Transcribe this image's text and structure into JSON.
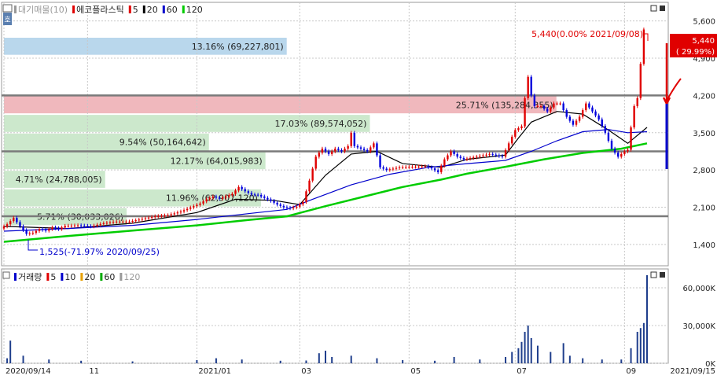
{
  "chart_data": [
    {
      "type": "candlestick",
      "legend": [
        {
          "text": "대기매물(10)",
          "color": "#999999",
          "marker": "#999999"
        },
        {
          "text": "에코플라스틱",
          "color": "#222222",
          "marker": "#e00000"
        },
        {
          "text": "5",
          "color": "#222222",
          "marker": "#e00000"
        },
        {
          "text": "20",
          "color": "#222222",
          "marker": "#000000"
        },
        {
          "text": "60",
          "color": "#222222",
          "marker": "#0000cc"
        },
        {
          "text": "120",
          "color": "#222222",
          "marker": "#00cc00"
        }
      ],
      "y_ticks": [
        {
          "v": 5600,
          "label": "5,600"
        },
        {
          "v": 4900,
          "label": "4,900"
        },
        {
          "v": 4200,
          "label": "4,200"
        },
        {
          "v": 3500,
          "label": "3,500"
        },
        {
          "v": 2800,
          "label": "2,800"
        },
        {
          "v": 2100,
          "label": "2,100"
        },
        {
          "v": 1400,
          "label": "1,400"
        }
      ],
      "ylim": [
        1000,
        5950
      ],
      "x_labels": [
        {
          "t": 0,
          "label": "2020/09/14"
        },
        {
          "t": 0.13,
          "label": "11"
        },
        {
          "t": 0.3,
          "label": "2021/01"
        },
        {
          "t": 0.46,
          "label": "03"
        },
        {
          "t": 0.63,
          "label": "05"
        },
        {
          "t": 0.795,
          "label": "07"
        },
        {
          "t": 0.965,
          "label": "09"
        }
      ],
      "end_date_label": "2021/09/15",
      "volume_profile": [
        {
          "label": "13.16% (69,227,801)",
          "from": 4950,
          "to": 5300,
          "share": 13.16,
          "color": "#b9d7ec"
        },
        {
          "label": "25.71% (135,284,355)",
          "from": 3850,
          "to": 4200,
          "share": 25.71,
          "color": "#f0b8bd"
        },
        {
          "label": "17.03% (89,574,052)",
          "from": 3500,
          "to": 3850,
          "share": 17.03,
          "color": "#cce8cc"
        },
        {
          "label": "9.54% (50,164,642)",
          "from": 3150,
          "to": 3500,
          "share": 9.54,
          "color": "#cce8cc"
        },
        {
          "label": "12.17% (64,015,983)",
          "from": 2800,
          "to": 3150,
          "share": 12.17,
          "color": "#cce8cc"
        },
        {
          "label": "4.71% (24,788,005)",
          "from": 2450,
          "to": 2800,
          "share": 4.71,
          "color": "#cce8cc"
        },
        {
          "label": "11.96% (62,907,120)",
          "from": 2100,
          "to": 2450,
          "share": 11.96,
          "color": "#cce8cc"
        },
        {
          "label": "5.71% (30,033,026)",
          "from": 1750,
          "to": 2100,
          "share": 5.71,
          "color": "#cce8cc"
        }
      ],
      "horizontal_levels": [
        4200,
        3150,
        1930
      ],
      "annotations": {
        "high": "5,440(0.00% 2021/09/08)",
        "low": "1,525(-71.97% 2020/09/25)",
        "last_price": "5,440",
        "last_change": "( 29.99%)"
      },
      "price_points": [
        [
          0,
          1700
        ],
        [
          0.01,
          1780
        ],
        [
          0.02,
          1900
        ],
        [
          0.03,
          1740
        ],
        [
          0.04,
          1600
        ],
        [
          0.05,
          1620
        ],
        [
          0.06,
          1690
        ],
        [
          0.07,
          1660
        ],
        [
          0.08,
          1720
        ],
        [
          0.09,
          1690
        ],
        [
          0.1,
          1750
        ],
        [
          0.12,
          1760
        ],
        [
          0.14,
          1740
        ],
        [
          0.16,
          1800
        ],
        [
          0.18,
          1830
        ],
        [
          0.2,
          1830
        ],
        [
          0.22,
          1880
        ],
        [
          0.24,
          1930
        ],
        [
          0.26,
          1950
        ],
        [
          0.28,
          2020
        ],
        [
          0.3,
          2120
        ],
        [
          0.31,
          2170
        ],
        [
          0.32,
          2250
        ],
        [
          0.33,
          2300
        ],
        [
          0.34,
          2260
        ],
        [
          0.36,
          2350
        ],
        [
          0.37,
          2480
        ],
        [
          0.38,
          2400
        ],
        [
          0.39,
          2340
        ],
        [
          0.4,
          2330
        ],
        [
          0.42,
          2220
        ],
        [
          0.43,
          2150
        ],
        [
          0.44,
          2100
        ],
        [
          0.45,
          2080
        ],
        [
          0.46,
          2110
        ],
        [
          0.47,
          2200
        ],
        [
          0.48,
          2600
        ],
        [
          0.49,
          3050
        ],
        [
          0.5,
          3200
        ],
        [
          0.51,
          3100
        ],
        [
          0.52,
          3200
        ],
        [
          0.53,
          3150
        ],
        [
          0.54,
          3250
        ],
        [
          0.545,
          3500
        ],
        [
          0.55,
          3250
        ],
        [
          0.56,
          3200
        ],
        [
          0.57,
          3150
        ],
        [
          0.58,
          3300
        ],
        [
          0.59,
          2850
        ],
        [
          0.6,
          2800
        ],
        [
          0.62,
          2850
        ],
        [
          0.64,
          2860
        ],
        [
          0.66,
          2870
        ],
        [
          0.67,
          2830
        ],
        [
          0.68,
          2760
        ],
        [
          0.69,
          3000
        ],
        [
          0.7,
          3150
        ],
        [
          0.71,
          3050
        ],
        [
          0.72,
          3000
        ],
        [
          0.74,
          3050
        ],
        [
          0.76,
          3100
        ],
        [
          0.78,
          3050
        ],
        [
          0.79,
          3300
        ],
        [
          0.8,
          3550
        ],
        [
          0.81,
          3620
        ],
        [
          0.815,
          4150
        ],
        [
          0.82,
          4550
        ],
        [
          0.825,
          4200
        ],
        [
          0.83,
          4000
        ],
        [
          0.84,
          4000
        ],
        [
          0.85,
          3900
        ],
        [
          0.86,
          4050
        ],
        [
          0.87,
          4050
        ],
        [
          0.88,
          3800
        ],
        [
          0.89,
          3650
        ],
        [
          0.9,
          3800
        ],
        [
          0.91,
          4050
        ],
        [
          0.92,
          3900
        ],
        [
          0.93,
          3750
        ],
        [
          0.94,
          3500
        ],
        [
          0.95,
          3200
        ],
        [
          0.96,
          3050
        ],
        [
          0.97,
          3150
        ],
        [
          0.975,
          3180
        ],
        [
          0.98,
          3600
        ],
        [
          0.985,
          4000
        ],
        [
          0.99,
          4150
        ],
        [
          1.0,
          5440
        ]
      ],
      "ma_lines": [
        {
          "name": "20",
          "color": "#000000",
          "points": [
            [
              0,
              1740
            ],
            [
              0.1,
              1700
            ],
            [
              0.2,
              1800
            ],
            [
              0.3,
              2000
            ],
            [
              0.36,
              2250
            ],
            [
              0.42,
              2230
            ],
            [
              0.46,
              2150
            ],
            [
              0.5,
              2700
            ],
            [
              0.54,
              3100
            ],
            [
              0.58,
              3150
            ],
            [
              0.62,
              2920
            ],
            [
              0.68,
              2850
            ],
            [
              0.72,
              3000
            ],
            [
              0.78,
              3080
            ],
            [
              0.8,
              3400
            ],
            [
              0.82,
              3700
            ],
            [
              0.86,
              3900
            ],
            [
              0.9,
              3850
            ],
            [
              0.94,
              3550
            ],
            [
              0.97,
              3300
            ],
            [
              1.0,
              3600
            ]
          ]
        },
        {
          "name": "60",
          "color": "#0000cc",
          "points": [
            [
              0,
              1650
            ],
            [
              0.1,
              1700
            ],
            [
              0.2,
              1760
            ],
            [
              0.3,
              1870
            ],
            [
              0.38,
              1980
            ],
            [
              0.44,
              2060
            ],
            [
              0.48,
              2250
            ],
            [
              0.54,
              2520
            ],
            [
              0.6,
              2720
            ],
            [
              0.66,
              2850
            ],
            [
              0.72,
              2920
            ],
            [
              0.78,
              2980
            ],
            [
              0.82,
              3150
            ],
            [
              0.86,
              3350
            ],
            [
              0.9,
              3520
            ],
            [
              0.94,
              3560
            ],
            [
              0.97,
              3500
            ],
            [
              1.0,
              3520
            ]
          ]
        },
        {
          "name": "120",
          "color": "#00cc00",
          "points": [
            [
              0,
              1450
            ],
            [
              0.1,
              1560
            ],
            [
              0.2,
              1660
            ],
            [
              0.3,
              1760
            ],
            [
              0.38,
              1860
            ],
            [
              0.44,
              1930
            ],
            [
              0.5,
              2120
            ],
            [
              0.56,
              2300
            ],
            [
              0.62,
              2480
            ],
            [
              0.68,
              2620
            ],
            [
              0.72,
              2730
            ],
            [
              0.78,
              2860
            ],
            [
              0.84,
              3000
            ],
            [
              0.9,
              3120
            ],
            [
              0.96,
              3200
            ],
            [
              1.0,
              3300
            ]
          ]
        }
      ]
    },
    {
      "type": "bar",
      "legend": [
        {
          "text": "거래량",
          "color": "#222222",
          "marker": "#0000cc"
        },
        {
          "text": "5",
          "color": "#222222",
          "marker": "#e00000"
        },
        {
          "text": "10",
          "color": "#222222",
          "marker": "#0000cc"
        },
        {
          "text": "20",
          "color": "#222222",
          "marker": "#e8a000"
        },
        {
          "text": "60",
          "color": "#222222",
          "marker": "#00aa00"
        },
        {
          "text": "120",
          "color": "#999999",
          "marker": "#999999"
        }
      ],
      "y_ticks": [
        {
          "v": 60000,
          "label": "60,000K"
        },
        {
          "v": 30000,
          "label": "30,000K"
        },
        {
          "v": 0,
          "label": "0K"
        }
      ],
      "ylim": [
        0,
        75000
      ],
      "bars": [
        [
          0.005,
          4000
        ],
        [
          0.01,
          18000
        ],
        [
          0.03,
          6000
        ],
        [
          0.07,
          3000
        ],
        [
          0.12,
          2000
        ],
        [
          0.2,
          1500
        ],
        [
          0.3,
          2500
        ],
        [
          0.33,
          4000
        ],
        [
          0.37,
          3000
        ],
        [
          0.43,
          2000
        ],
        [
          0.47,
          2200
        ],
        [
          0.49,
          8000
        ],
        [
          0.5,
          10000
        ],
        [
          0.51,
          5000
        ],
        [
          0.54,
          6000
        ],
        [
          0.58,
          4000
        ],
        [
          0.62,
          2500
        ],
        [
          0.67,
          2000
        ],
        [
          0.7,
          5000
        ],
        [
          0.74,
          3000
        ],
        [
          0.78,
          5000
        ],
        [
          0.79,
          9000
        ],
        [
          0.8,
          12000
        ],
        [
          0.805,
          17000
        ],
        [
          0.81,
          25000
        ],
        [
          0.815,
          30000
        ],
        [
          0.82,
          20000
        ],
        [
          0.83,
          14000
        ],
        [
          0.85,
          9000
        ],
        [
          0.87,
          16000
        ],
        [
          0.88,
          6000
        ],
        [
          0.9,
          4000
        ],
        [
          0.93,
          3000
        ],
        [
          0.96,
          3000
        ],
        [
          0.975,
          12000
        ],
        [
          0.985,
          25000
        ],
        [
          0.99,
          28000
        ],
        [
          0.995,
          32000
        ],
        [
          1.0,
          70000
        ]
      ]
    }
  ]
}
